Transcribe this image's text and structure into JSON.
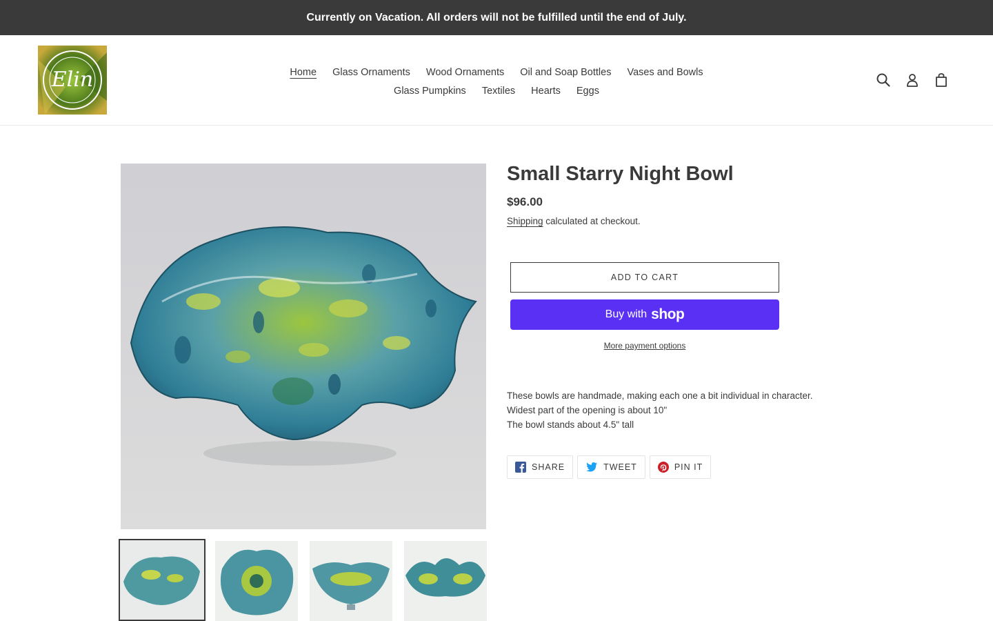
{
  "announcement": "Currently on Vacation. All orders will not be fulfilled until the end of July.",
  "logo": {
    "text": "Elin",
    "alt": "Elin logo"
  },
  "nav": {
    "row1": [
      {
        "label": "Home",
        "active": true
      },
      {
        "label": "Glass Ornaments"
      },
      {
        "label": "Wood Ornaments"
      },
      {
        "label": "Oil and Soap Bottles"
      },
      {
        "label": "Vases and Bowls"
      }
    ],
    "row2": [
      {
        "label": "Glass Pumpkins"
      },
      {
        "label": "Textiles"
      },
      {
        "label": "Hearts"
      },
      {
        "label": "Eggs"
      }
    ]
  },
  "header_icons": [
    "search-icon",
    "account-icon",
    "cart-icon"
  ],
  "product": {
    "title": "Small Starry Night Bowl",
    "price": "$96.00",
    "shipping_link": "Shipping",
    "shipping_rest": " calculated at checkout.",
    "add_to_cart": "ADD TO CART",
    "buy_with": "Buy with",
    "buy_brand": "shop",
    "more_payment": "More payment options",
    "description": [
      "These bowls are handmade, making each one a bit individual in character.",
      "Widest part of the opening is about 10\"",
      "The bowl stands about 4.5\" tall"
    ]
  },
  "share": {
    "facebook": "SHARE",
    "twitter": "TWEET",
    "pinterest": "PIN IT"
  },
  "thumbnails": {
    "count": 4,
    "selected_index": 0
  },
  "colors": {
    "announcement_bg": "#3a3a3a",
    "text": "#3a3a3a",
    "shop_pay": "#5a31f4",
    "bowl_green": "#8fb63a",
    "bowl_blue": "#3e8fa6"
  }
}
